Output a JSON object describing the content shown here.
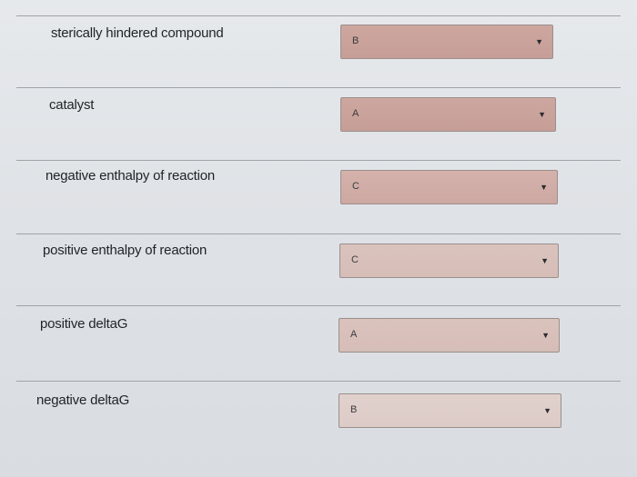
{
  "rows": [
    {
      "label": "sterically hindered compound",
      "value": "B",
      "arrow_icon": "dropdown-arrow-icon"
    },
    {
      "label": "catalyst",
      "value": "A",
      "arrow_icon": "dropdown-arrow-icon"
    },
    {
      "label": "negative enthalpy of reaction",
      "value": "C",
      "arrow_icon": "dropdown-arrow-icon"
    },
    {
      "label": "positive enthalpy of reaction",
      "value": "C",
      "arrow_icon": "dropdown-arrow-icon"
    },
    {
      "label": "positive deltaG",
      "value": "A",
      "arrow_icon": "dropdown-arrow-icon"
    },
    {
      "label": "negative deltaG",
      "value": "B",
      "arrow_icon": "dropdown-arrow-icon"
    }
  ],
  "dropdown_arrow": "▼",
  "colors": {
    "background": "#e0e3e7",
    "divider": "#9fa4a8",
    "text": "#1f2327",
    "select_fill": "#cda79f",
    "select_border": "#9a8f8c"
  }
}
